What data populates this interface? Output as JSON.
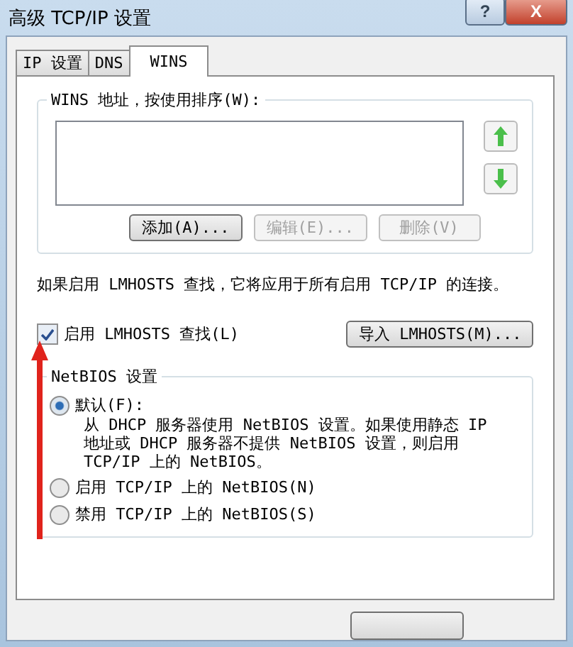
{
  "window": {
    "title": "高级 TCP/IP 设置",
    "help": "?",
    "close": "X"
  },
  "tabs": [
    {
      "label": "IP 设置",
      "selected": false
    },
    {
      "label": "DNS",
      "selected": false
    },
    {
      "label": "WINS",
      "selected": true
    }
  ],
  "wins": {
    "label": "WINS 地址，按使用排序(W):",
    "buttons": [
      {
        "label": "添加(A)...",
        "disabled": false
      },
      {
        "label": "编辑(E)...",
        "disabled": true
      },
      {
        "label": "删除(V)",
        "disabled": true
      }
    ]
  },
  "lmhosts_note": "如果启用 LMHOSTS 查找，它将应用于所有启用 TCP/IP 的连接。",
  "lmhosts": {
    "label": "启用 LMHOSTS 查找(L)",
    "checked": true,
    "import_button": "导入 LMHOSTS(M)..."
  },
  "netbios": {
    "title": "NetBIOS 设置",
    "options": [
      {
        "label": "默认(F):",
        "description": "从 DHCP 服务器使用 NetBIOS 设置。如果使用静态 IP 地址或 DHCP 服务器不提供 NetBIOS 设置，则启用 TCP/IP 上的 NetBIOS。",
        "selected": true
      },
      {
        "label": "启用 TCP/IP 上的 NetBIOS(N)",
        "selected": false
      },
      {
        "label": "禁用 TCP/IP 上的 NetBIOS(S)",
        "selected": false
      }
    ]
  },
  "annotation": {
    "kind": "arrow"
  }
}
